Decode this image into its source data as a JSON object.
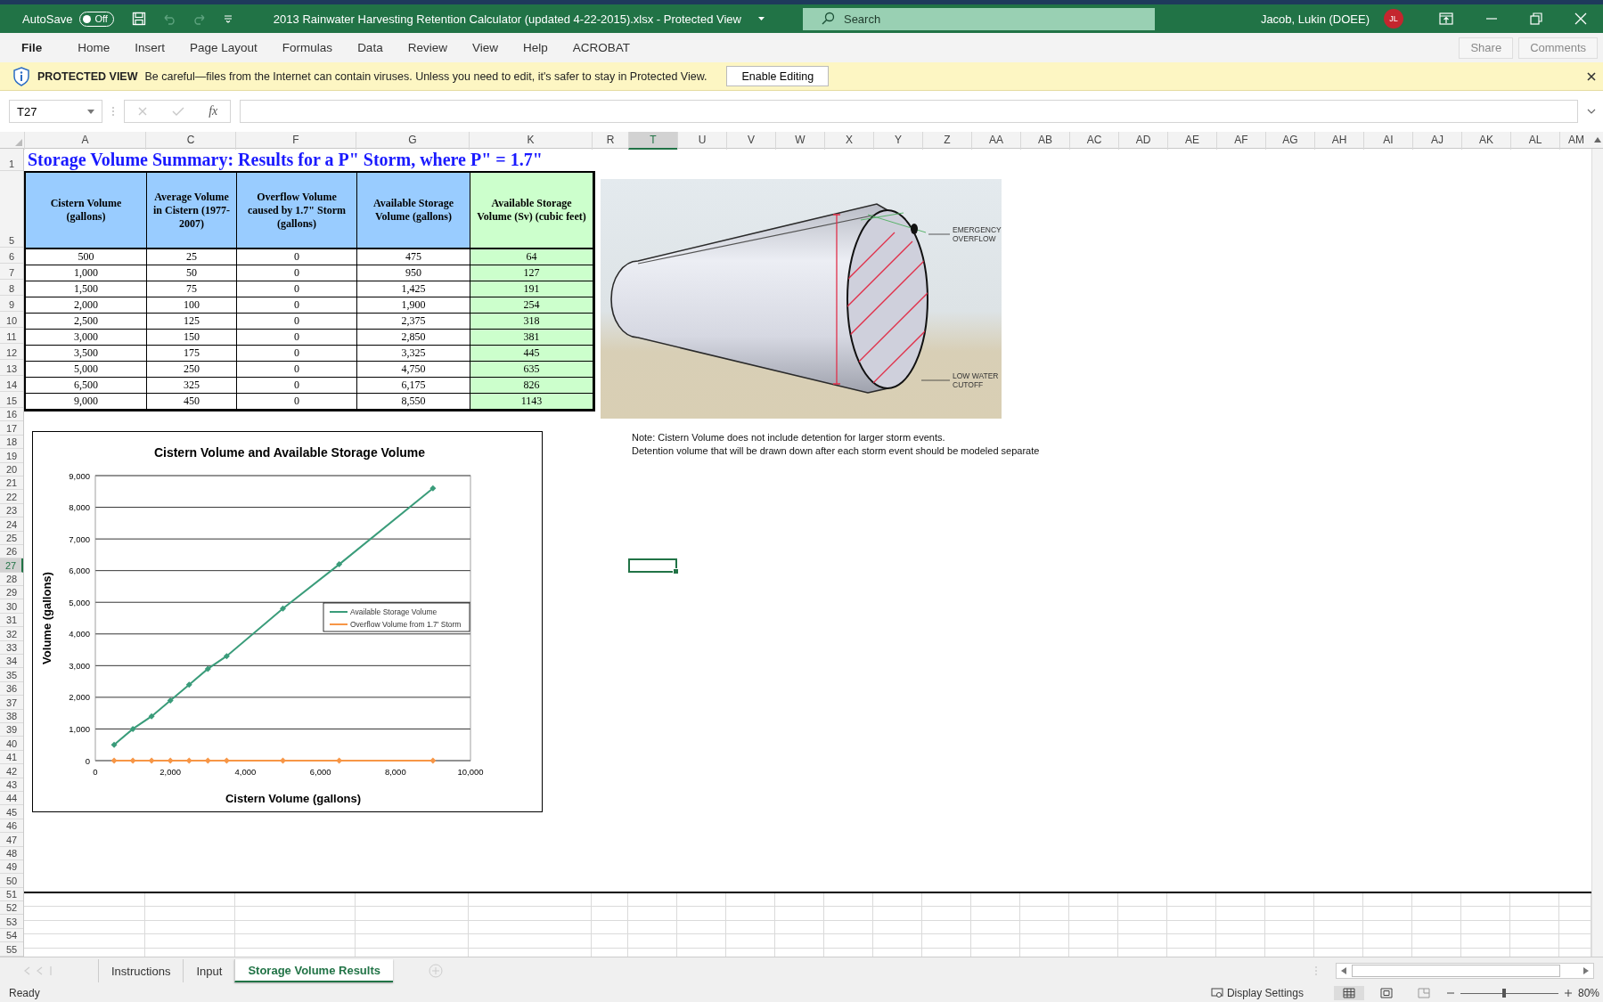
{
  "title_bar": {
    "autosave_label": "AutoSave",
    "autosave": {
      "label": "Off",
      "on": false
    },
    "title": "2013 Rainwater Harvesting Retention Calculator (updated 4-22-2015).xlsx  -  Protected View",
    "search": {
      "placeholder": "Search"
    },
    "user": "Jacob, Lukin (DOEE)",
    "avatar": "JL"
  },
  "ribbon_tabs": [
    "File",
    "Home",
    "Insert",
    "Page Layout",
    "Formulas",
    "Data",
    "Review",
    "View",
    "Help",
    "ACROBAT"
  ],
  "ribbon_buttons": [
    {
      "label": "Share",
      "disabled": true
    },
    {
      "label": "Comments",
      "disabled": true
    }
  ],
  "protected_bar": {
    "heading": "PROTECTED VIEW",
    "message": "Be careful—files from the Internet can contain viruses. Unless you need to edit, it's safer to stay in Protected View.",
    "button": "Enable Editing"
  },
  "formula_bar": {
    "name_box": "T27",
    "fx": "fx"
  },
  "columns": [
    {
      "label": "A",
      "selected": false
    },
    {
      "label": "C",
      "selected": false
    },
    {
      "label": "F",
      "selected": false
    },
    {
      "label": "G",
      "selected": false
    },
    {
      "label": "K",
      "selected": false
    },
    {
      "label": "R",
      "selected": false
    },
    {
      "label": "T",
      "selected": true
    },
    {
      "label": "U",
      "selected": false
    },
    {
      "label": "V",
      "selected": false
    },
    {
      "label": "W",
      "selected": false
    },
    {
      "label": "X",
      "selected": false
    },
    {
      "label": "Y",
      "selected": false
    },
    {
      "label": "Z",
      "selected": false
    },
    {
      "label": "AA",
      "selected": false
    },
    {
      "label": "AB",
      "selected": false
    },
    {
      "label": "AC",
      "selected": false
    },
    {
      "label": "AD",
      "selected": false
    },
    {
      "label": "AE",
      "selected": false
    },
    {
      "label": "AF",
      "selected": false
    },
    {
      "label": "AG",
      "selected": false
    },
    {
      "label": "AH",
      "selected": false
    },
    {
      "label": "AI",
      "selected": false
    },
    {
      "label": "AJ",
      "selected": false
    },
    {
      "label": "AK",
      "selected": false
    },
    {
      "label": "AL",
      "selected": false
    },
    {
      "label": "AM",
      "selected": false
    }
  ],
  "rows": [
    {
      "label": "1",
      "selected": false
    },
    {
      "label": "5",
      "selected": false
    },
    {
      "label": "6",
      "selected": false
    },
    {
      "label": "7",
      "selected": false
    },
    {
      "label": "8",
      "selected": false
    },
    {
      "label": "9",
      "selected": false
    },
    {
      "label": "10",
      "selected": false
    },
    {
      "label": "11",
      "selected": false
    },
    {
      "label": "12",
      "selected": false
    },
    {
      "label": "13",
      "selected": false
    },
    {
      "label": "14",
      "selected": false
    },
    {
      "label": "15",
      "selected": false
    },
    {
      "label": "16",
      "selected": false
    },
    {
      "label": "17",
      "selected": false
    },
    {
      "label": "18",
      "selected": false
    },
    {
      "label": "19",
      "selected": false
    },
    {
      "label": "20",
      "selected": false
    },
    {
      "label": "21",
      "selected": false
    },
    {
      "label": "22",
      "selected": false
    },
    {
      "label": "23",
      "selected": false
    },
    {
      "label": "24",
      "selected": false
    },
    {
      "label": "25",
      "selected": false
    },
    {
      "label": "26",
      "selected": false
    },
    {
      "label": "27",
      "selected": true
    },
    {
      "label": "28",
      "selected": false
    },
    {
      "label": "29",
      "selected": false
    },
    {
      "label": "30",
      "selected": false
    },
    {
      "label": "31",
      "selected": false
    },
    {
      "label": "32",
      "selected": false
    },
    {
      "label": "33",
      "selected": false
    },
    {
      "label": "34",
      "selected": false
    },
    {
      "label": "35",
      "selected": false
    },
    {
      "label": "36",
      "selected": false
    },
    {
      "label": "37",
      "selected": false
    },
    {
      "label": "38",
      "selected": false
    },
    {
      "label": "39",
      "selected": false
    },
    {
      "label": "40",
      "selected": false
    },
    {
      "label": "41",
      "selected": false
    },
    {
      "label": "42",
      "selected": false
    },
    {
      "label": "43",
      "selected": false
    },
    {
      "label": "44",
      "selected": false
    },
    {
      "label": "45",
      "selected": false
    },
    {
      "label": "46",
      "selected": false
    },
    {
      "label": "47",
      "selected": false
    },
    {
      "label": "48",
      "selected": false
    },
    {
      "label": "49",
      "selected": false
    },
    {
      "label": "50",
      "selected": false
    },
    {
      "label": "51",
      "selected": false
    },
    {
      "label": "52",
      "selected": false
    },
    {
      "label": "53",
      "selected": false
    },
    {
      "label": "54",
      "selected": false
    },
    {
      "label": "55",
      "selected": false
    }
  ],
  "sheet": {
    "title": "Storage Volume Summary: Results for a P\" Storm, where P\" = 1.7\"",
    "table": {
      "columns": [
        {
          "label": "Cistern Volume (gallons)",
          "color": "#99ccff",
          "highlight": false
        },
        {
          "label": "Average Volume in Cistern (1977-2007)",
          "color": "#99ccff",
          "highlight": false
        },
        {
          "label": "Overflow Volume caused by 1.7\" Storm (gallons)",
          "color": "#99ccff",
          "highlight": false
        },
        {
          "label": "Available Storage Volume (gallons)",
          "color": "#99ccff",
          "highlight": false
        },
        {
          "label": "Available Storage Volume (Sv) (cubic feet)",
          "color": "#ccffcc",
          "highlight": true
        }
      ],
      "rows": [
        [
          "500",
          "25",
          "0",
          "475",
          "64"
        ],
        [
          "1,000",
          "50",
          "0",
          "950",
          "127"
        ],
        [
          "1,500",
          "75",
          "0",
          "1,425",
          "191"
        ],
        [
          "2,000",
          "100",
          "0",
          "1,900",
          "254"
        ],
        [
          "2,500",
          "125",
          "0",
          "2,375",
          "318"
        ],
        [
          "3,000",
          "150",
          "0",
          "2,850",
          "381"
        ],
        [
          "3,500",
          "175",
          "0",
          "3,325",
          "445"
        ],
        [
          "5,000",
          "250",
          "0",
          "4,750",
          "635"
        ],
        [
          "6,500",
          "325",
          "0",
          "6,175",
          "826"
        ],
        [
          "9,000",
          "450",
          "0",
          "8,550",
          "1143"
        ]
      ]
    },
    "picture": {
      "labels": [
        {
          "lines": [
            "EMERGENCY",
            "OVERFLOW"
          ]
        },
        {
          "lines": [
            "LOW WATER",
            "CUTOFF"
          ]
        }
      ]
    },
    "note": [
      "Note: Cistern Volume does not include detention for larger storm events.",
      "Detention volume that will be drawn down after each storm event should be modeled separate"
    ],
    "chart": {
      "chart_data": {
        "type": "line",
        "title": "Cistern Volume and Available Storage Volume",
        "xlabel": "Cistern Volume (gallons)",
        "ylabel": "Volume (gallons)",
        "x": [
          500,
          1000,
          1500,
          2000,
          2500,
          3000,
          3500,
          5000,
          6500,
          9000
        ],
        "series": [
          {
            "name": "Available Storage Volume",
            "color": "#3a9c7a",
            "marker": "diamond",
            "values": [
              500,
              1000,
              1400,
              1900,
              2400,
              2900,
              3300,
              4800,
              6200,
              8600
            ]
          },
          {
            "name": "Overflow Volume from 1.7' Storm",
            "color": "#f79646",
            "marker": "diamond",
            "values": [
              0,
              0,
              0,
              0,
              0,
              0,
              0,
              0,
              0,
              0
            ]
          }
        ],
        "grid": true,
        "legend": true,
        "xlim": [
          0,
          10000
        ],
        "ylim": [
          0,
          9000
        ],
        "xticks": [
          {
            "value": 0,
            "label": "0"
          },
          {
            "value": 2000,
            "label": "2,000"
          },
          {
            "value": 4000,
            "label": "4,000"
          },
          {
            "value": 6000,
            "label": "6,000"
          },
          {
            "value": 8000,
            "label": "8,000"
          },
          {
            "value": 10000,
            "label": "10,000"
          }
        ],
        "yticks": [
          {
            "value": 0,
            "label": "0"
          },
          {
            "value": 1000,
            "label": "1,000"
          },
          {
            "value": 2000,
            "label": "2,000"
          },
          {
            "value": 3000,
            "label": "3,000"
          },
          {
            "value": 4000,
            "label": "4,000"
          },
          {
            "value": 5000,
            "label": "5,000"
          },
          {
            "value": 6000,
            "label": "6,000"
          },
          {
            "value": 7000,
            "label": "7,000"
          },
          {
            "value": 8000,
            "label": "8,000"
          },
          {
            "value": 9000,
            "label": "9,000"
          }
        ]
      }
    }
  },
  "sheet_tabs": [
    {
      "label": "Instructions",
      "selected": false
    },
    {
      "label": "Input",
      "selected": false
    },
    {
      "label": "Storage Volume Results",
      "selected": true
    }
  ],
  "status_bar": {
    "status": "Ready",
    "display_settings": "Display Settings",
    "views": [
      {
        "kind": "normal",
        "selected": true
      },
      {
        "kind": "page_layout",
        "selected": false
      },
      {
        "kind": "page_break",
        "selected": false
      }
    ],
    "zoom": {
      "level": 0.45,
      "reading": "80%"
    }
  }
}
